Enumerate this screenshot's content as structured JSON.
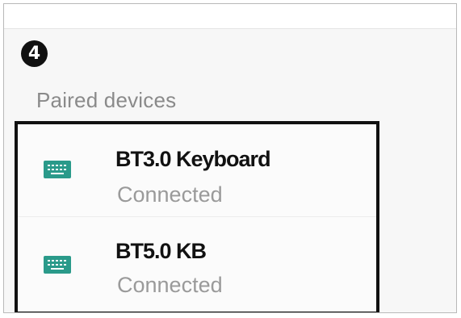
{
  "step": {
    "number": "4"
  },
  "section": {
    "header": "Paired devices"
  },
  "devices": [
    {
      "name": "BT3.0 Keyboard",
      "status": "Connected",
      "icon": "keyboard-icon"
    },
    {
      "name": "BT5.0 KB",
      "status": "Connected",
      "icon": "keyboard-icon"
    }
  ],
  "colors": {
    "icon": "#2a9a8a",
    "highlight_border": "#111111",
    "status_text": "#9a9a9a",
    "header_text": "#8a8a8a"
  }
}
